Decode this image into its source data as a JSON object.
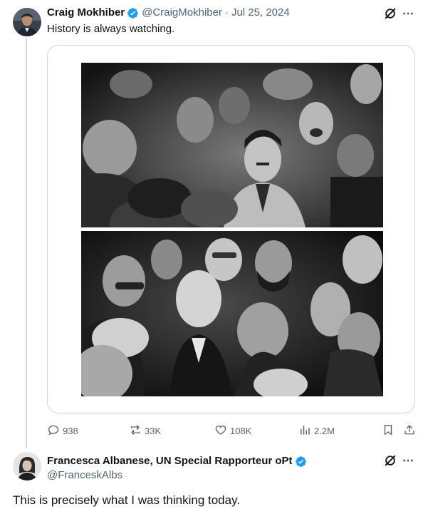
{
  "tweet": {
    "author_name": "Craig Mokhiber",
    "handle": "@CraigMokhiber",
    "separator": "·",
    "date": "Jul 25, 2024",
    "text": "History is always watching.",
    "stats": {
      "replies": "938",
      "reposts": "33K",
      "likes": "108K",
      "views": "2.2M"
    }
  },
  "reply": {
    "author_name": "Francesca Albanese, UN Special Rapporteur oPt",
    "handle": "@FranceskAlbs",
    "text": "This is precisely what I was thinking today."
  },
  "icons": {
    "verified": "verified-badge-icon",
    "grok": "grok-icon",
    "more": "more-icon",
    "reply": "reply-icon",
    "repost": "repost-icon",
    "like": "like-icon",
    "views": "views-icon",
    "bookmark": "bookmark-icon",
    "share": "share-icon"
  },
  "colors": {
    "verified": "#1d9bf0",
    "text_primary": "#0f1419",
    "text_secondary": "#536471",
    "border": "#cfd9de"
  }
}
